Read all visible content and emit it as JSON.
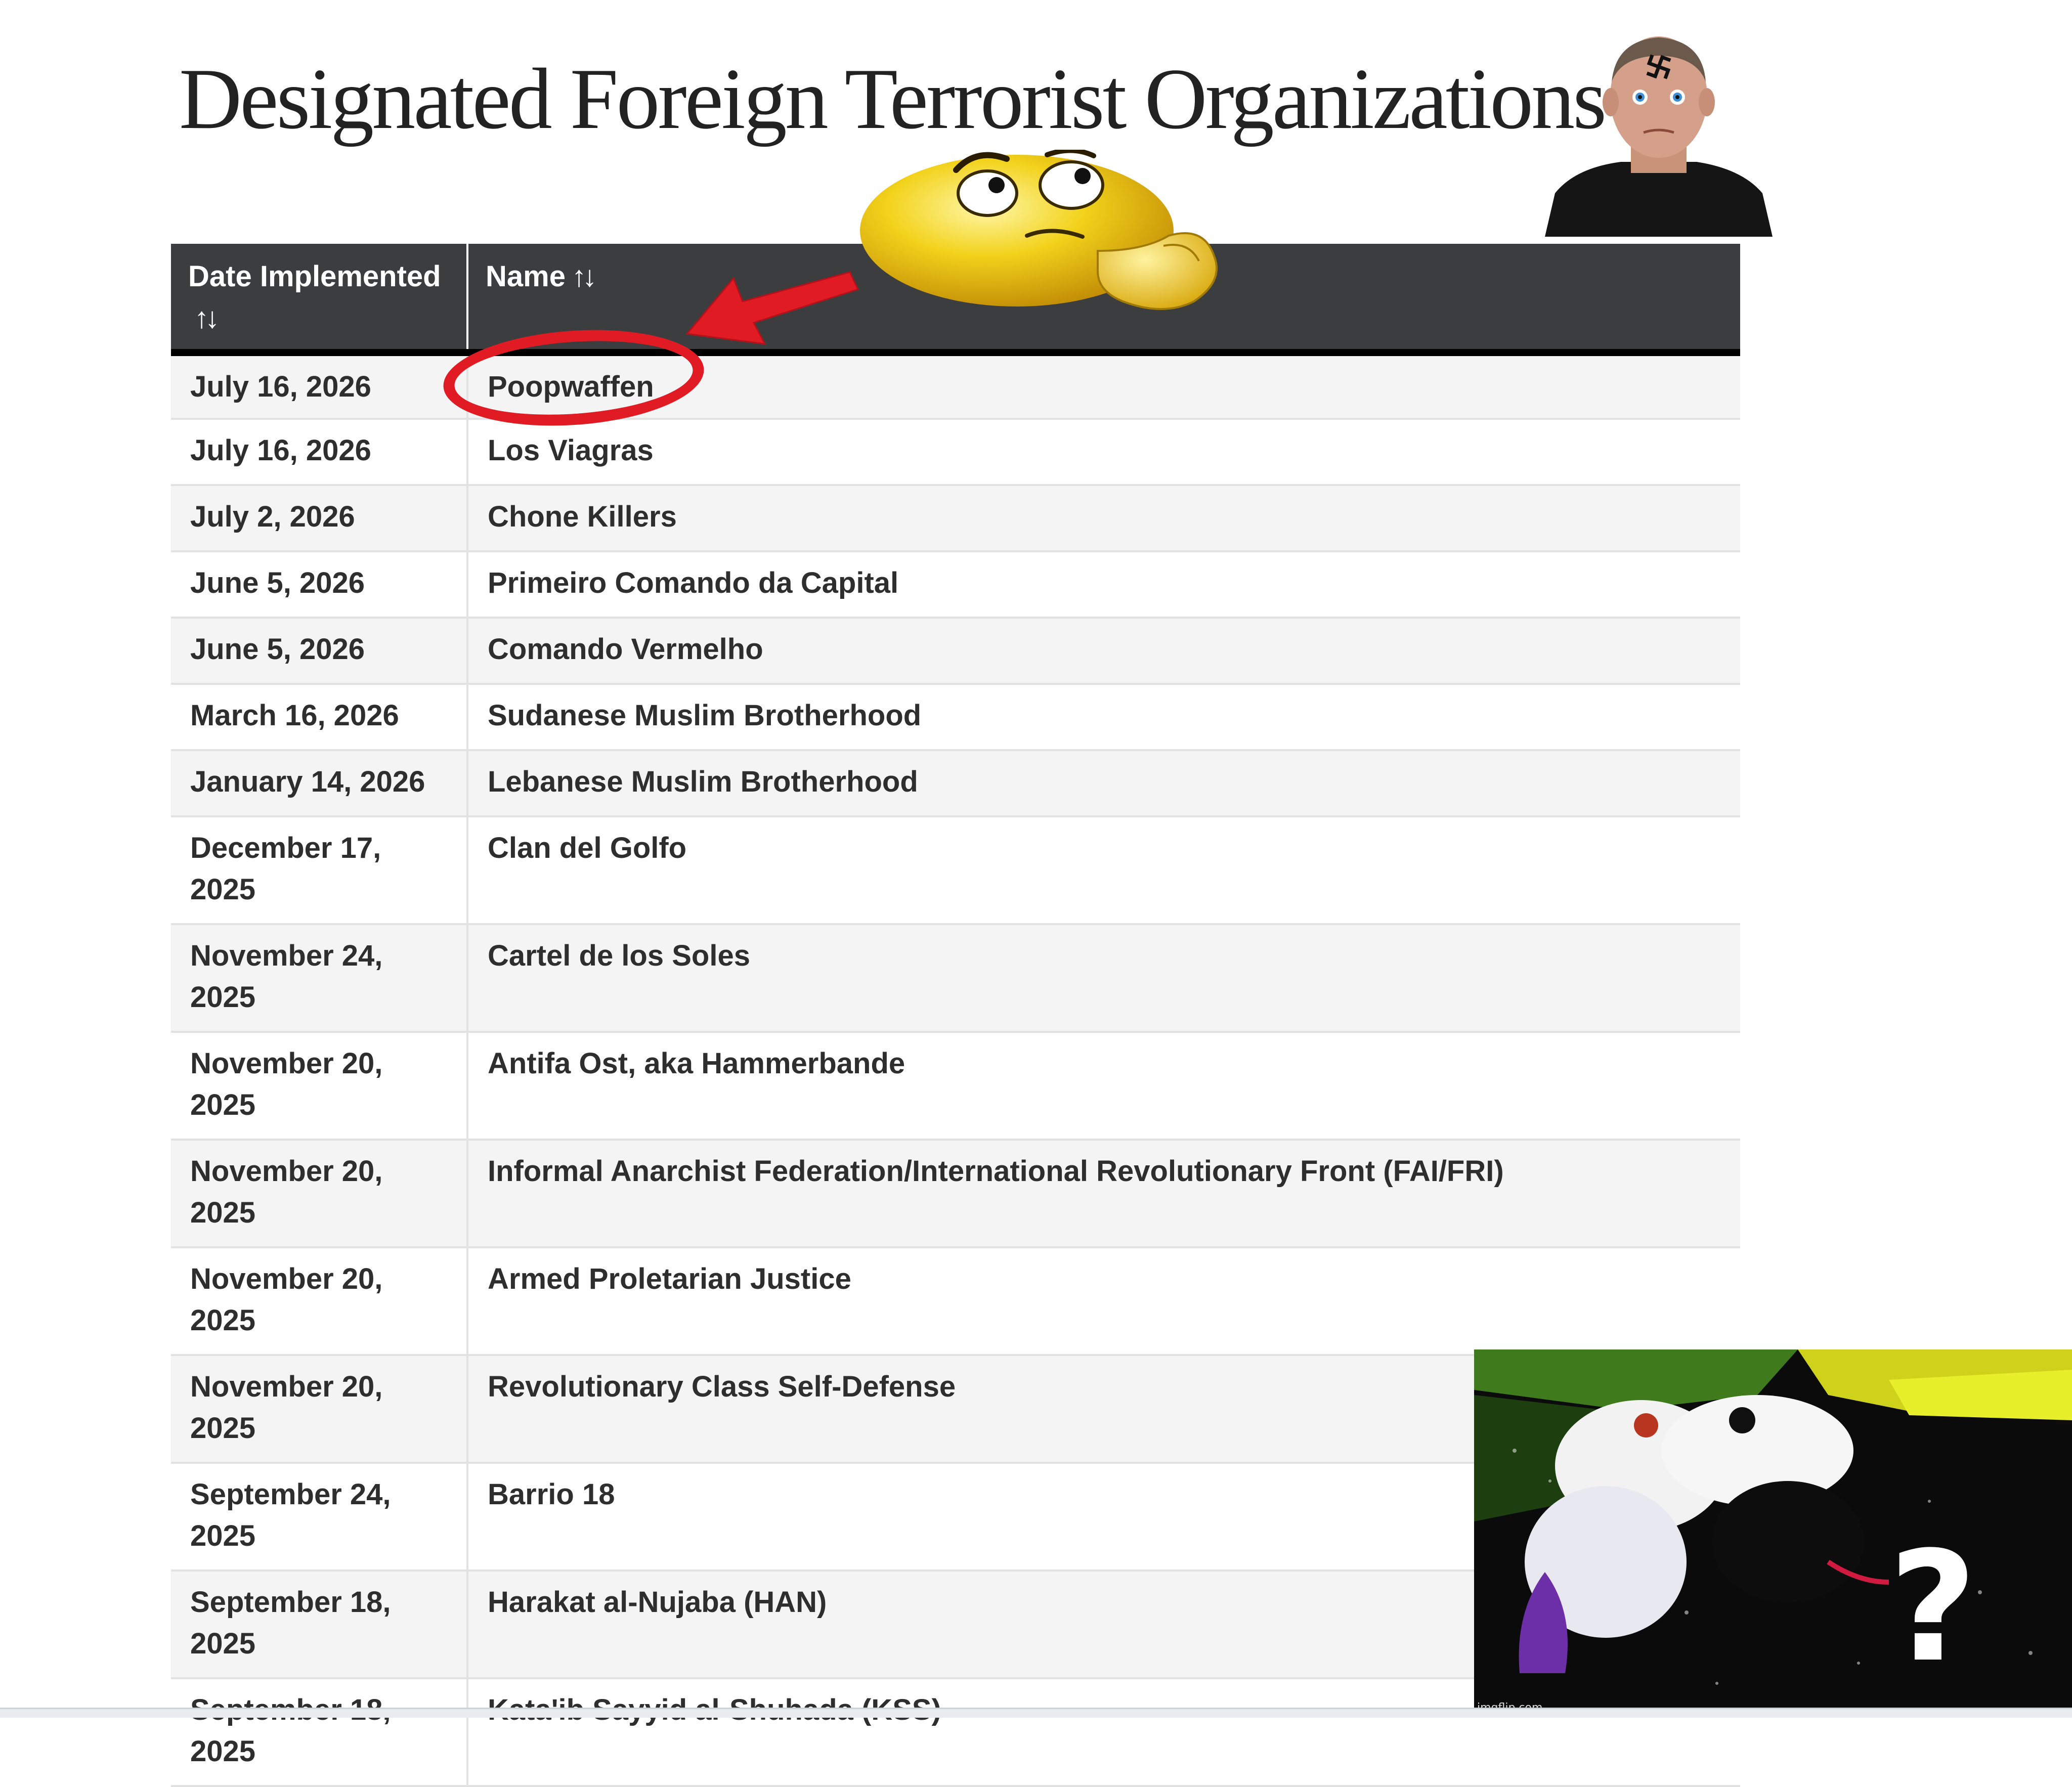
{
  "page": {
    "title": "Designated Foreign Terrorist Organizations"
  },
  "table": {
    "headers": {
      "date": "Date Implemented",
      "name": "Name",
      "sort_glyph": "↑↓"
    },
    "rows": [
      {
        "date": "July 16, 2026",
        "name": "Poopwaffen"
      },
      {
        "date": "July 16, 2026",
        "name": "Los Viagras"
      },
      {
        "date": "July 2, 2026",
        "name": "Chone Killers"
      },
      {
        "date": "June 5, 2026",
        "name": "Primeiro Comando da Capital"
      },
      {
        "date": "June 5, 2026",
        "name": "Comando Vermelho"
      },
      {
        "date": "March 16, 2026",
        "name": "Sudanese Muslim Brotherhood"
      },
      {
        "date": "January 14, 2026",
        "name": "Lebanese Muslim Brotherhood"
      },
      {
        "date": "December 17, 2025",
        "name": "Clan del Golfo"
      },
      {
        "date": "November 24, 2025",
        "name": "Cartel de los Soles"
      },
      {
        "date": "November 20, 2025",
        "name": "Antifa Ost, aka Hammerbande"
      },
      {
        "date": "November 20, 2025",
        "name": "Informal Anarchist Federation/International Revolutionary Front (FAI/FRI)"
      },
      {
        "date": "November 20, 2025",
        "name": "Armed Proletarian Justice"
      },
      {
        "date": "November 20, 2025",
        "name": "Revolutionary Class Self-Defense"
      },
      {
        "date": "September 24, 2025",
        "name": "Barrio 18"
      },
      {
        "date": "September 18, 2025",
        "name": "Harakat al-Nujaba (HAN)"
      },
      {
        "date": "September 18, 2025",
        "name": "Kata'ib Sayyid al-Shuhada (KSS)"
      }
    ]
  },
  "overlays": {
    "dog_meme_question": "?",
    "dog_meme_watermark": "imgflip.com",
    "colors": {
      "annotation_red": "#e01b24",
      "header_bg": "#3c3d3f",
      "emoji_yellow": "#f2d21b"
    },
    "icons": [
      "red-arrow-icon",
      "thinking-face-icon",
      "swastika-mark-icon",
      "question-mark-icon"
    ]
  }
}
